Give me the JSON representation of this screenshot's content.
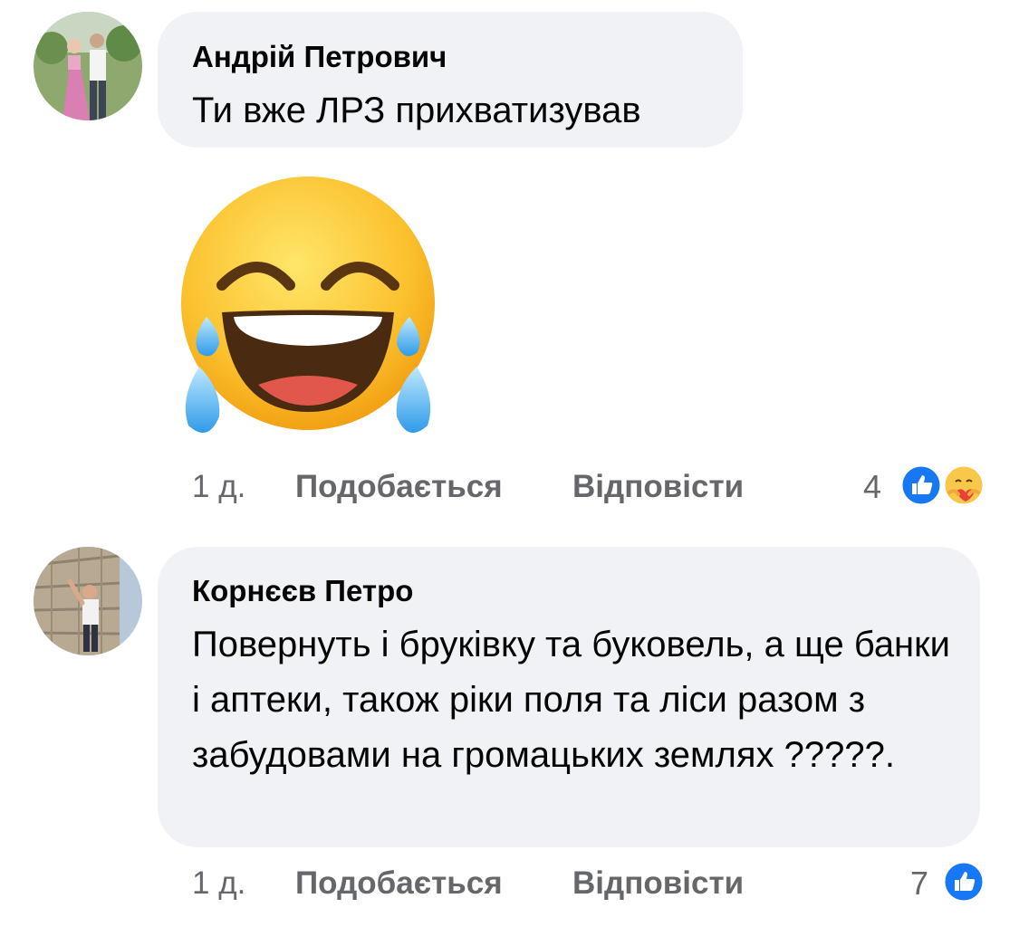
{
  "comments": [
    {
      "author": "Андрій Петрович",
      "text": "Ти вже ЛРЗ прихватизував",
      "avatar": "profile-photo",
      "sticker": "face-with-tears-of-joy-emoji",
      "time": "1 д.",
      "like_label": "Подобається",
      "reply_label": "Відповісти",
      "reaction_count": "4",
      "reactions": [
        "like-icon",
        "care-icon"
      ]
    },
    {
      "author": "Корнєєв Петро",
      "text": "Повернуть і бруківку та буковель, а ще банки і аптеки, також ріки поля та ліси разом з забудовами на громацьких землях ?????.",
      "avatar": "profile-photo",
      "time": "1 д.",
      "like_label": "Подобається",
      "reply_label": "Відповісти",
      "reaction_count": "7",
      "reactions": [
        "like-icon"
      ]
    }
  ],
  "colors": {
    "bubble": "#f0f2f5",
    "meta_text": "#65676b",
    "like_blue": "#1877f2"
  }
}
